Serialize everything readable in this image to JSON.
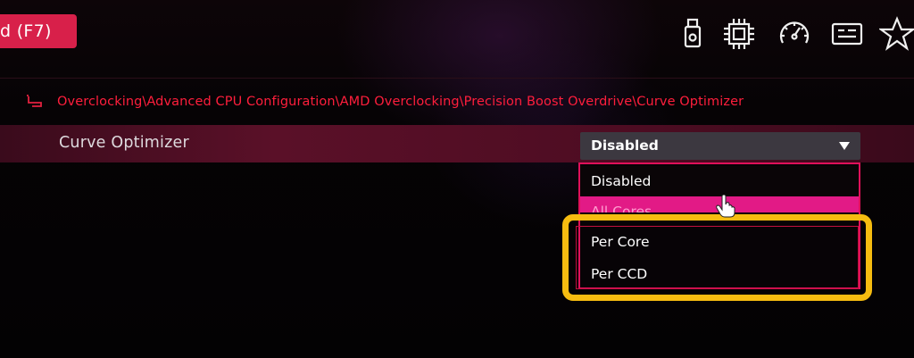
{
  "top_bar": {
    "mode_button_label": "d (F7)",
    "icons": [
      "usb-icon",
      "cpu-icon",
      "speedometer-icon",
      "board-explorer-icon",
      "favorite-star-icon"
    ]
  },
  "breadcrumb": {
    "path": "Overclocking\\Advanced CPU Configuration\\AMD Overclocking\\Precision Boost Overdrive\\Curve Optimizer"
  },
  "setting": {
    "label": "Curve Optimizer",
    "selected_value": "Disabled"
  },
  "dropdown": {
    "options": [
      "Disabled",
      "All Cores",
      "Per Core",
      "Per CCD"
    ],
    "hovered_index": 1
  },
  "colors": {
    "accent": "#d8204a",
    "breadcrumb": "#ff1e3c",
    "hover_option": "#e21a86",
    "highlight": "#f6bc10"
  }
}
